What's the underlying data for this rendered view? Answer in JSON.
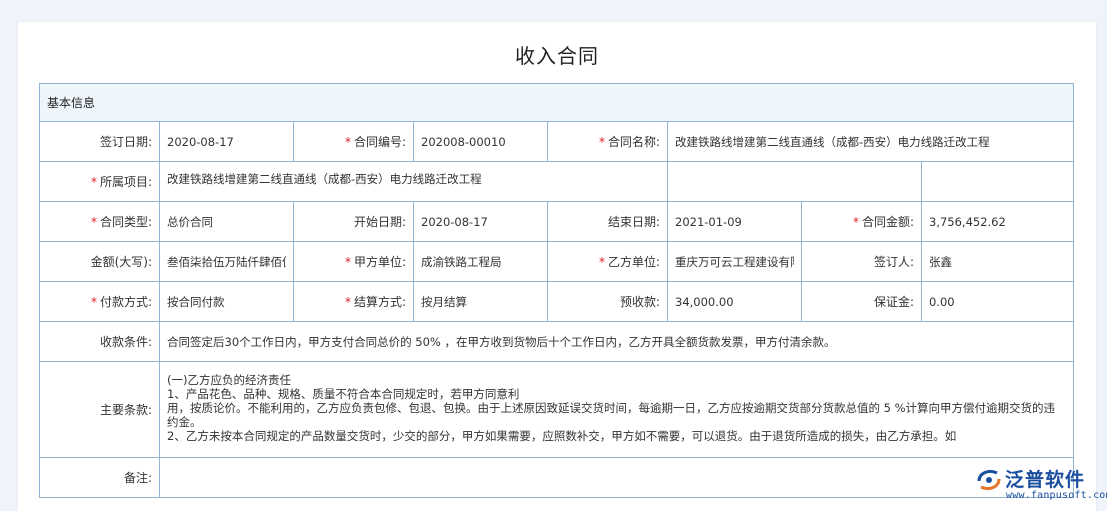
{
  "page": {
    "title": "收入合同"
  },
  "section": {
    "basic_info": "基本信息"
  },
  "fields": {
    "sign_date": {
      "label": "签订日期:",
      "value": "2020-08-17"
    },
    "contract_no": {
      "label": "合同编号:",
      "value": "202008-00010"
    },
    "contract_name": {
      "label": "合同名称:",
      "value": "改建铁路线增建第二线直通线（成都-西安）电力线路迁改工程"
    },
    "project": {
      "label": "所属项目:",
      "value": "改建铁路线增建第二线直通线（成都-西安）电力线路迁改工程"
    },
    "contract_type": {
      "label": "合同类型:",
      "value": "总价合同"
    },
    "start_date": {
      "label": "开始日期:",
      "value": "2020-08-17"
    },
    "end_date": {
      "label": "结束日期:",
      "value": "2021-01-09"
    },
    "amount": {
      "label": "合同金额:",
      "value": "3,756,452.62"
    },
    "amount_upper": {
      "label": "金额(大写):",
      "value": "叁佰柒拾伍万陆仟肆佰伍拾贰元陆角贰分"
    },
    "party_a": {
      "label": "甲方单位:",
      "value": "成渝铁路工程局"
    },
    "party_b": {
      "label": "乙方单位:",
      "value": "重庆万可云工程建设有限公司"
    },
    "signer": {
      "label": "签订人:",
      "value": "张鑫"
    },
    "payment_method": {
      "label": "付款方式:",
      "value": "按合同付款"
    },
    "settlement_method": {
      "label": "结算方式:",
      "value": "按月结算"
    },
    "prepayment": {
      "label": "预收款:",
      "value": "34,000.00"
    },
    "deposit": {
      "label": "保证金:",
      "value": "0.00"
    },
    "collection_terms": {
      "label": "收款条件:",
      "value": "合同签定后30个工作日内，甲方支付合同总价的 50% ，在甲方收到货物后十个工作日内，乙方开具全额货款发票，甲方付清余款。"
    },
    "main_clauses": {
      "label": "主要条款:",
      "lines": [
        "(一)乙方应负的经济责任",
        "1、产品花色、品种、规格、质量不符合本合同规定时，若甲方同意利",
        "用，按质论价。不能利用的，乙方应负责包修、包退、包换。由于上述原因致延误交货时间，每逾期一日，乙方应按逾期交货部分货款总值的 5 %计算向甲方偿付逾期交货的违约金。",
        "2、乙方未按本合同规定的产品数量交货时，少交的部分，甲方如果需要，应照数补交，甲方如不需要，可以退货。由于退货所造成的损失，由乙方承担。如"
      ]
    },
    "remarks": {
      "label": "备注:",
      "value": ""
    }
  },
  "logo": {
    "name": "泛普软件",
    "url": "www.fanpusoft.com"
  },
  "colors": {
    "border": "#92b4d4",
    "section_bg": "#eef6fc",
    "required": "#e02020",
    "brand": "#1a4fa0"
  }
}
